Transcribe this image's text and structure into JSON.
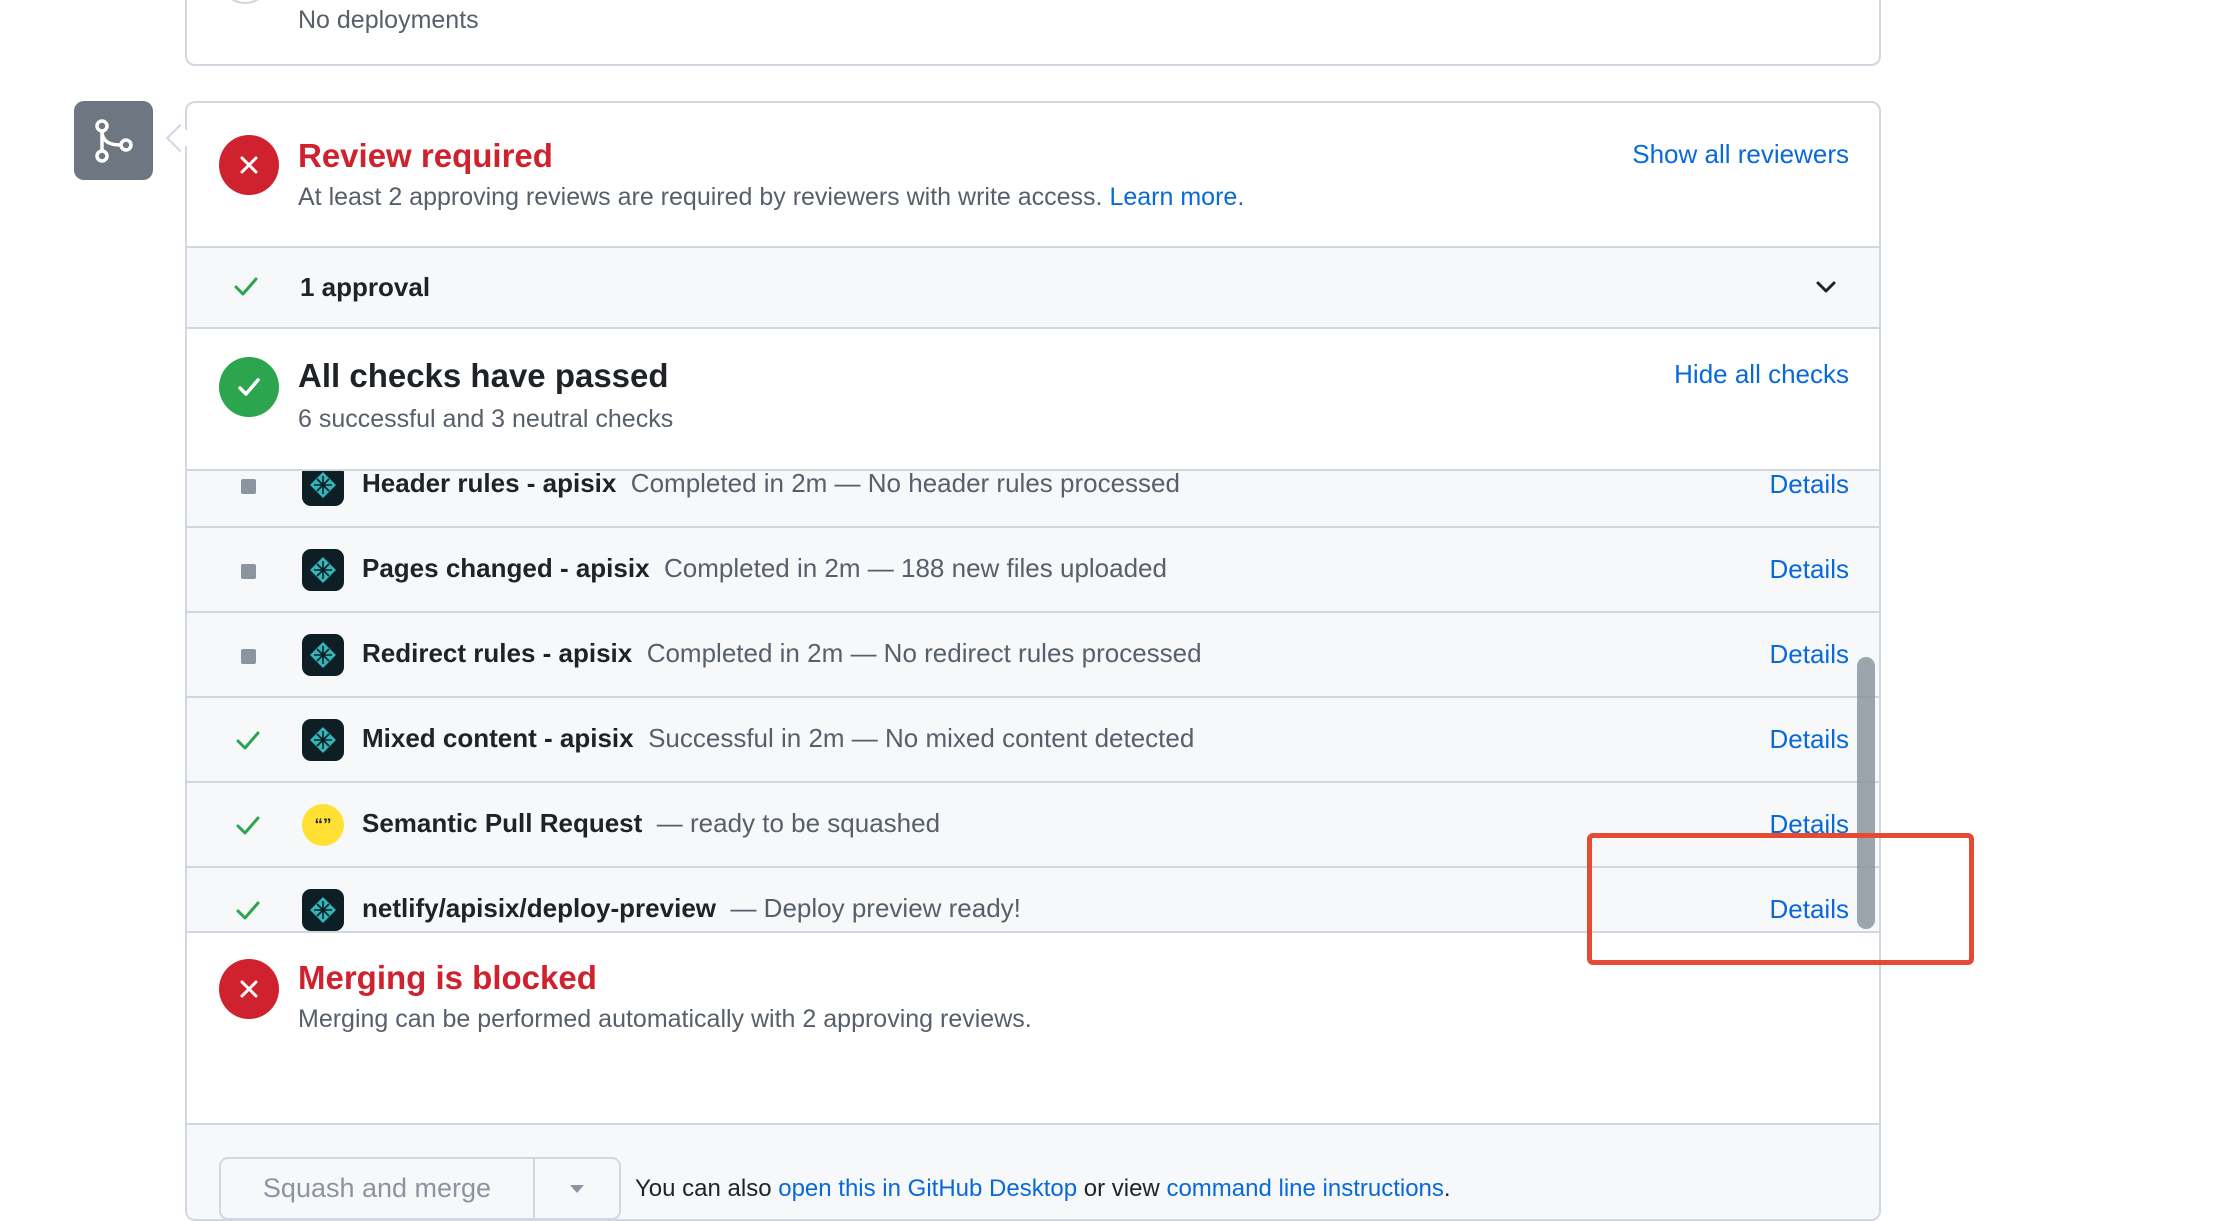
{
  "deployments": {
    "text": "No deployments"
  },
  "review": {
    "title": "Review required",
    "subtitle": "At least 2 approving reviews are required by reviewers with write access.",
    "learn_more": "Learn more.",
    "show_all": "Show all reviewers",
    "approval_label": "1 approval"
  },
  "checks": {
    "title": "All checks have passed",
    "subtitle": "6 successful and 3 neutral checks",
    "hide_all": "Hide all checks",
    "items": [
      {
        "status": "neutral",
        "icon": "netlify-icon",
        "name": "Header rules - apisix",
        "desc": "Completed in 2m — No header rules processed",
        "link": "Details"
      },
      {
        "status": "neutral",
        "icon": "netlify-icon",
        "name": "Pages changed - apisix",
        "desc": "Completed in 2m — 188 new files uploaded",
        "link": "Details"
      },
      {
        "status": "neutral",
        "icon": "netlify-icon",
        "name": "Redirect rules - apisix",
        "desc": "Completed in 2m — No redirect rules processed",
        "link": "Details"
      },
      {
        "status": "success",
        "icon": "netlify-icon",
        "name": "Mixed content - apisix",
        "desc": "Successful in 2m — No mixed content detected",
        "link": "Details"
      },
      {
        "status": "success",
        "icon": "semantic-pr-icon",
        "name": "Semantic Pull Request",
        "desc": "— ready to be squashed",
        "link": "Details"
      },
      {
        "status": "success",
        "icon": "netlify-icon",
        "name": "netlify/apisix/deploy-preview",
        "desc": "— Deploy preview ready!",
        "link": "Details"
      }
    ]
  },
  "merge": {
    "title": "Merging is blocked",
    "subtitle": "Merging can be performed automatically with 2 approving reviews.",
    "button_label": "Squash and merge",
    "hint_prefix": "You can also",
    "hint_link1": "open this in GitHub Desktop",
    "hint_middle": "or view",
    "hint_link2": "command line instructions",
    "hint_suffix": "."
  },
  "colors": {
    "danger": "#cf222e",
    "success": "#2da44e",
    "link": "#0969da",
    "highlight": "#e34b35"
  }
}
